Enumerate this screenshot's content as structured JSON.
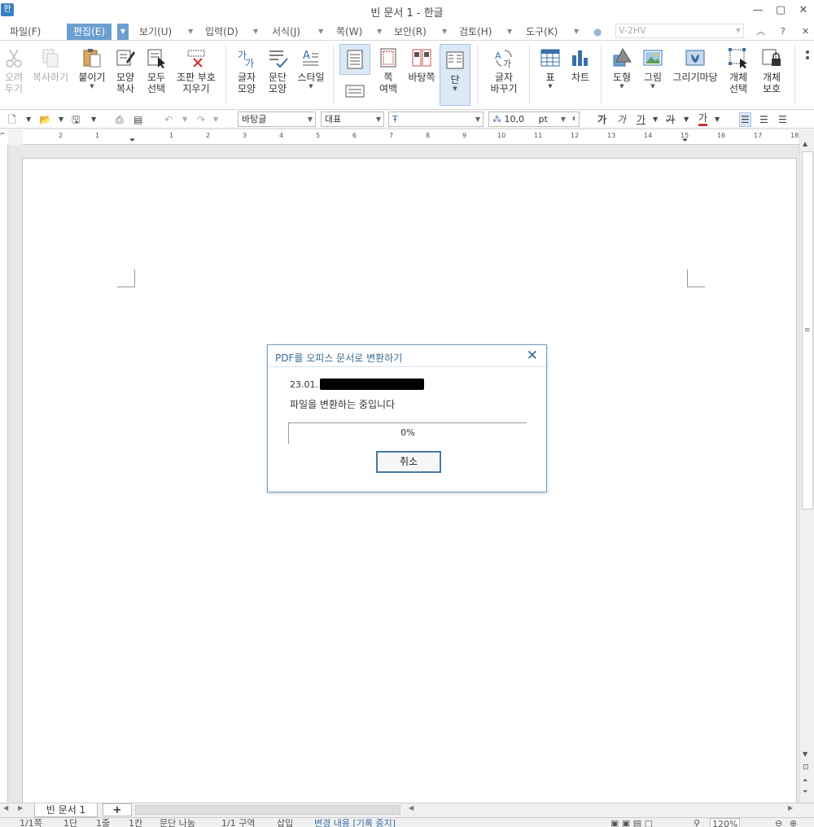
{
  "window": {
    "app_icon": "한",
    "title": "빈 문서 1 - 한글",
    "minimize": "—",
    "maximize": "▢",
    "close": "✕"
  },
  "menubar": {
    "items": [
      "파일(F)",
      "편집(E)",
      "보기(U)",
      "입력(D)",
      "서식(J)",
      "쪽(W)",
      "보안(R)",
      "검토(H)",
      "도구(K)"
    ],
    "active": "편집(E)",
    "combo_value": "V-2HV",
    "help": "?"
  },
  "ribbon": {
    "buttons": [
      {
        "line1": "오려",
        "line2": "두기",
        "icon": "scissors-icon",
        "enabled": false
      },
      {
        "line1": "복사하기",
        "line2": "",
        "icon": "copy-icon",
        "enabled": false
      },
      {
        "line1": "붙이기",
        "line2": "",
        "icon": "paste-icon",
        "enabled": true
      },
      {
        "line1": "모양",
        "line2": "복사",
        "icon": "format-copy-icon",
        "enabled": true
      },
      {
        "line1": "모두",
        "line2": "선택",
        "icon": "select-all-icon",
        "enabled": true
      },
      {
        "line1": "조판 부호",
        "line2": "지우기",
        "icon": "clear-marks-icon",
        "enabled": true
      },
      {
        "line1": "글자",
        "line2": "모양",
        "icon": "char-shape-icon",
        "enabled": true
      },
      {
        "line1": "문단",
        "line2": "모양",
        "icon": "para-shape-icon",
        "enabled": true
      },
      {
        "line1": "스타일",
        "line2": "",
        "icon": "style-icon",
        "enabled": true
      },
      {
        "line1": "쪽",
        "line2": "여백",
        "icon": "margin-icon",
        "enabled": true
      },
      {
        "line1": "바탕쪽",
        "line2": "",
        "icon": "master-page-icon",
        "enabled": true
      },
      {
        "line1": "단",
        "line2": "",
        "icon": "columns-icon",
        "enabled": true
      },
      {
        "line1": "글자",
        "line2": "바꾸기",
        "icon": "replace-icon",
        "enabled": true
      },
      {
        "line1": "표",
        "line2": "",
        "icon": "table-icon",
        "enabled": true
      },
      {
        "line1": "차트",
        "line2": "",
        "icon": "chart-icon",
        "enabled": true
      },
      {
        "line1": "도형",
        "line2": "",
        "icon": "shape-icon",
        "enabled": true
      },
      {
        "line1": "그림",
        "line2": "",
        "icon": "picture-icon",
        "enabled": true
      },
      {
        "line1": "그리기마당",
        "line2": "",
        "icon": "clipart-icon",
        "enabled": true
      },
      {
        "line1": "개체",
        "line2": "선택",
        "icon": "object-select-icon",
        "enabled": true
      },
      {
        "line1": "개체",
        "line2": "보호",
        "icon": "object-protect-icon",
        "enabled": true
      }
    ]
  },
  "format": {
    "style": "바탕글",
    "lang": "대표",
    "font": "",
    "size": "10,0",
    "unit": "pt",
    "bold": "가",
    "italic": "가",
    "underline": "가",
    "strike": "가",
    "color": "가"
  },
  "ruler": {
    "labels": [
      "2",
      "1",
      "1",
      "2",
      "3",
      "4",
      "5",
      "6",
      "7",
      "8",
      "9",
      "10",
      "11",
      "12",
      "13",
      "14",
      "15",
      "16",
      "17",
      "18"
    ]
  },
  "dialog": {
    "title": "PDF를 오피스 문서로 변환하기",
    "close": "✕",
    "file_prefix": "23.01.",
    "status": "파일을 변환하는 중입니다",
    "progress_text": "0%",
    "progress_value": 0,
    "cancel": "취소"
  },
  "tabs": {
    "doc": "빈 문서 1",
    "add": "+"
  },
  "statusbar": {
    "items": [
      "1/1쪽",
      "1단",
      "1줄",
      "1칸",
      "문단 나눔",
      "1/1 구역",
      "삽입",
      "변경 내용 [기록 중지]",
      "120%"
    ]
  },
  "colors": {
    "accent": "#6c9fd1",
    "dialog_title": "#3a6a97",
    "dialog_border": "#6f9fc6"
  }
}
